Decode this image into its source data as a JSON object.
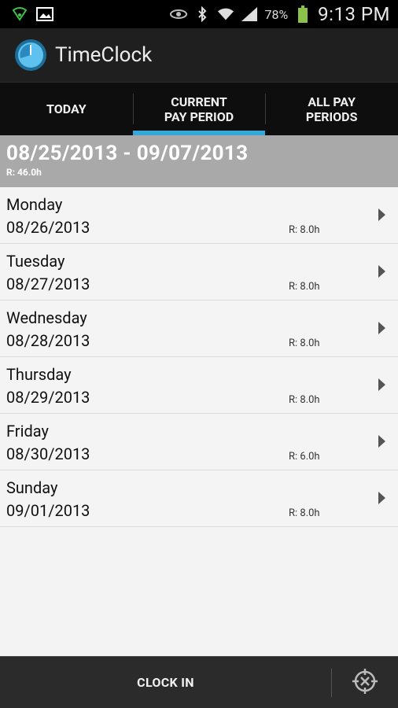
{
  "status_bar": {
    "battery_pct": "78%",
    "time": "9:13 PM",
    "icons": [
      "wifi-shield-icon",
      "image-icon",
      "eye-icon",
      "bluetooth-icon",
      "wifi-icon",
      "signal-icon",
      "battery-icon"
    ]
  },
  "app": {
    "title": "TimeClock",
    "icon": "clock-icon",
    "accent": "#35a7d8"
  },
  "tabs": [
    {
      "label": "TODAY",
      "active": false
    },
    {
      "label": "CURRENT\nPAY PERIOD",
      "active": true
    },
    {
      "label": "ALL PAY\nPERIODS",
      "active": false
    }
  ],
  "period": {
    "range": "08/25/2013 - 09/07/2013",
    "total": "R: 46.0h"
  },
  "days": [
    {
      "name": "Monday",
      "date": "08/26/2013",
      "hours": "R: 8.0h"
    },
    {
      "name": "Tuesday",
      "date": "08/27/2013",
      "hours": "R: 8.0h"
    },
    {
      "name": "Wednesday",
      "date": "08/28/2013",
      "hours": "R: 8.0h"
    },
    {
      "name": "Thursday",
      "date": "08/29/2013",
      "hours": "R: 8.0h"
    },
    {
      "name": "Friday",
      "date": "08/30/2013",
      "hours": "R: 6.0h"
    },
    {
      "name": "Sunday",
      "date": "09/01/2013",
      "hours": "R: 8.0h"
    }
  ],
  "bottom_bar": {
    "clock_in_label": "CLOCK IN",
    "locate_icon": "crosshair-icon"
  }
}
